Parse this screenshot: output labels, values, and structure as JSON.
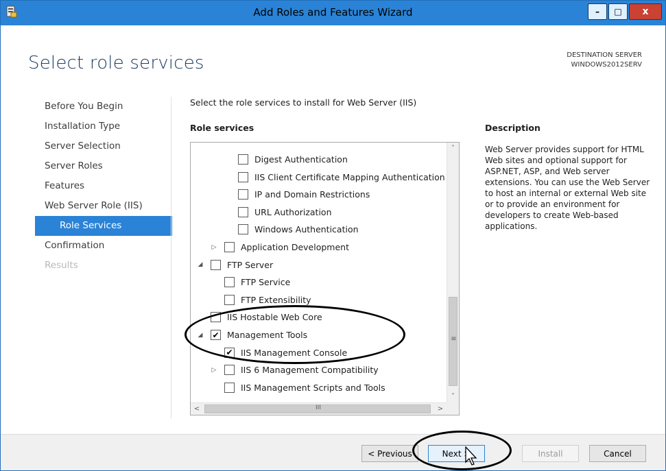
{
  "window": {
    "title": "Add Roles and Features Wizard",
    "controls": {
      "minimize": "–",
      "maximize": "□",
      "close": "x"
    }
  },
  "page": {
    "title": "Select role services",
    "destination_label": "DESTINATION SERVER",
    "destination_server": "WINDOWS2012SERV"
  },
  "nav": [
    {
      "label": "Before You Begin",
      "state": "normal"
    },
    {
      "label": "Installation Type",
      "state": "normal"
    },
    {
      "label": "Server Selection",
      "state": "normal"
    },
    {
      "label": "Server Roles",
      "state": "normal"
    },
    {
      "label": "Features",
      "state": "normal"
    },
    {
      "label": "Web Server Role (IIS)",
      "state": "normal"
    },
    {
      "label": "Role Services",
      "state": "active"
    },
    {
      "label": "Confirmation",
      "state": "normal"
    },
    {
      "label": "Results",
      "state": "disabled"
    }
  ],
  "main": {
    "instruction": "Select the role services to install for Web Server (IIS)",
    "role_services_header": "Role services",
    "description_header": "Description",
    "description_text": "Web Server provides support for HTML Web sites and optional support for ASP.NET, ASP, and Web server extensions. You can use the Web Server to host an internal or external Web site or to provide an environment for developers to create Web-based applications."
  },
  "tree": [
    {
      "label": "Digest Authentication",
      "level": 3,
      "expander": "",
      "checked": false
    },
    {
      "label": "IIS Client Certificate Mapping Authentication",
      "level": 3,
      "expander": "",
      "checked": false
    },
    {
      "label": "IP and Domain Restrictions",
      "level": 3,
      "expander": "",
      "checked": false
    },
    {
      "label": "URL Authorization",
      "level": 3,
      "expander": "",
      "checked": false
    },
    {
      "label": "Windows Authentication",
      "level": 3,
      "expander": "",
      "checked": false
    },
    {
      "label": "Application Development",
      "level": 2,
      "expander": "▷",
      "checked": false
    },
    {
      "label": "FTP Server",
      "level": 1,
      "expander": "◢",
      "checked": false
    },
    {
      "label": "FTP Service",
      "level": 2,
      "expander": "",
      "checked": false
    },
    {
      "label": "FTP Extensibility",
      "level": 2,
      "expander": "",
      "checked": false
    },
    {
      "label": "IIS Hostable Web Core",
      "level": 1,
      "expander": "",
      "checked": false
    },
    {
      "label": "Management Tools",
      "level": 1,
      "expander": "◢",
      "checked": true
    },
    {
      "label": "IIS Management Console",
      "level": 2,
      "expander": "",
      "checked": true
    },
    {
      "label": "IIS 6 Management Compatibility",
      "level": 2,
      "expander": "▷",
      "checked": false
    },
    {
      "label": "IIS Management Scripts and Tools",
      "level": 2,
      "expander": "",
      "checked": false
    }
  ],
  "scrollbar": {
    "up": "˄",
    "down": "˅",
    "left": "<",
    "right": ">",
    "vgrip": "≡",
    "hgrip": "III"
  },
  "buttons": {
    "previous": "< Previous",
    "next": "Next >",
    "install": "Install",
    "cancel": "Cancel"
  }
}
